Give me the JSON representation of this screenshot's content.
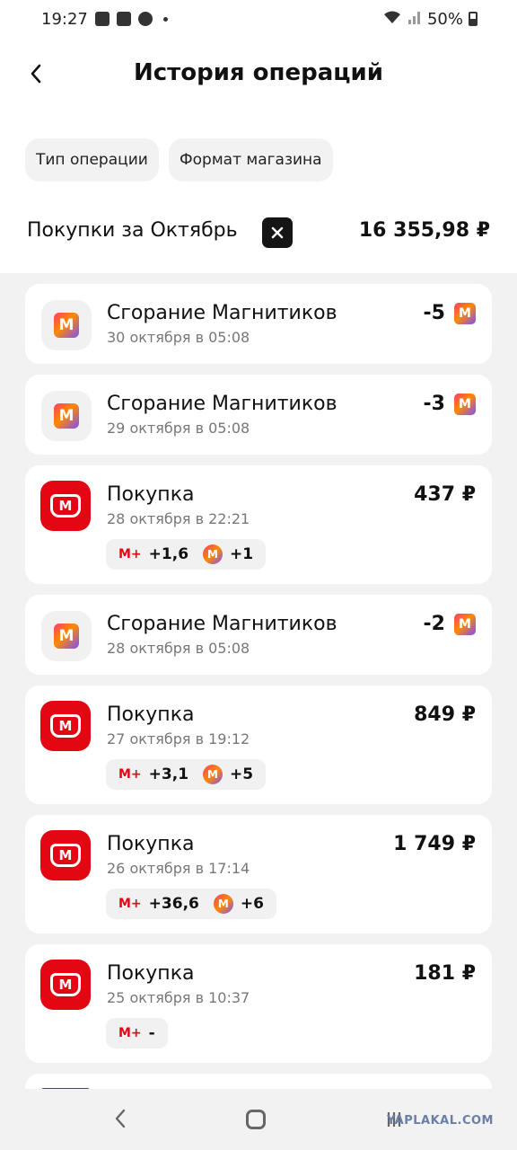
{
  "status_bar": {
    "time": "19:27",
    "battery": "50%"
  },
  "header": {
    "title": "История операций",
    "back_icon": "chevron-left-icon"
  },
  "filters": [
    {
      "label": "Тип операции"
    },
    {
      "label": "Формат магазина"
    }
  ],
  "summary": {
    "label": "Покупки за Октябрь",
    "total": "16 355,98 ₽"
  },
  "operations": [
    {
      "title": "Сгорание Магнитиков",
      "date": "30 октября в 05:08",
      "amount": "-5"
    },
    {
      "title": "Сгорание Магнитиков",
      "date": "29 октября в 05:08",
      "amount": "-3"
    },
    {
      "title": "Покупка",
      "date": "28 октября в 22:21",
      "amount": "437 ₽",
      "bonus_mplus": "+1,6",
      "bonus_coins": "+1"
    },
    {
      "title": "Сгорание Магнитиков",
      "date": "28 октября в 05:08",
      "amount": "-2"
    },
    {
      "title": "Покупка",
      "date": "27 октября в 19:12",
      "amount": "849 ₽",
      "bonus_mplus": "+3,1",
      "bonus_coins": "+5"
    },
    {
      "title": "Покупка",
      "date": "26 октября в 17:14",
      "amount": "1 749 ₽",
      "bonus_mplus": "+36,6",
      "bonus_coins": "+6"
    },
    {
      "title": "Покупка",
      "date": "25 октября в 10:37",
      "amount": "181 ₽",
      "bonus_mplus": "-"
    }
  ],
  "icons": {
    "mplus_label": "M+",
    "m_letter": "M"
  },
  "watermark": "YAPLAKAL.COM"
}
